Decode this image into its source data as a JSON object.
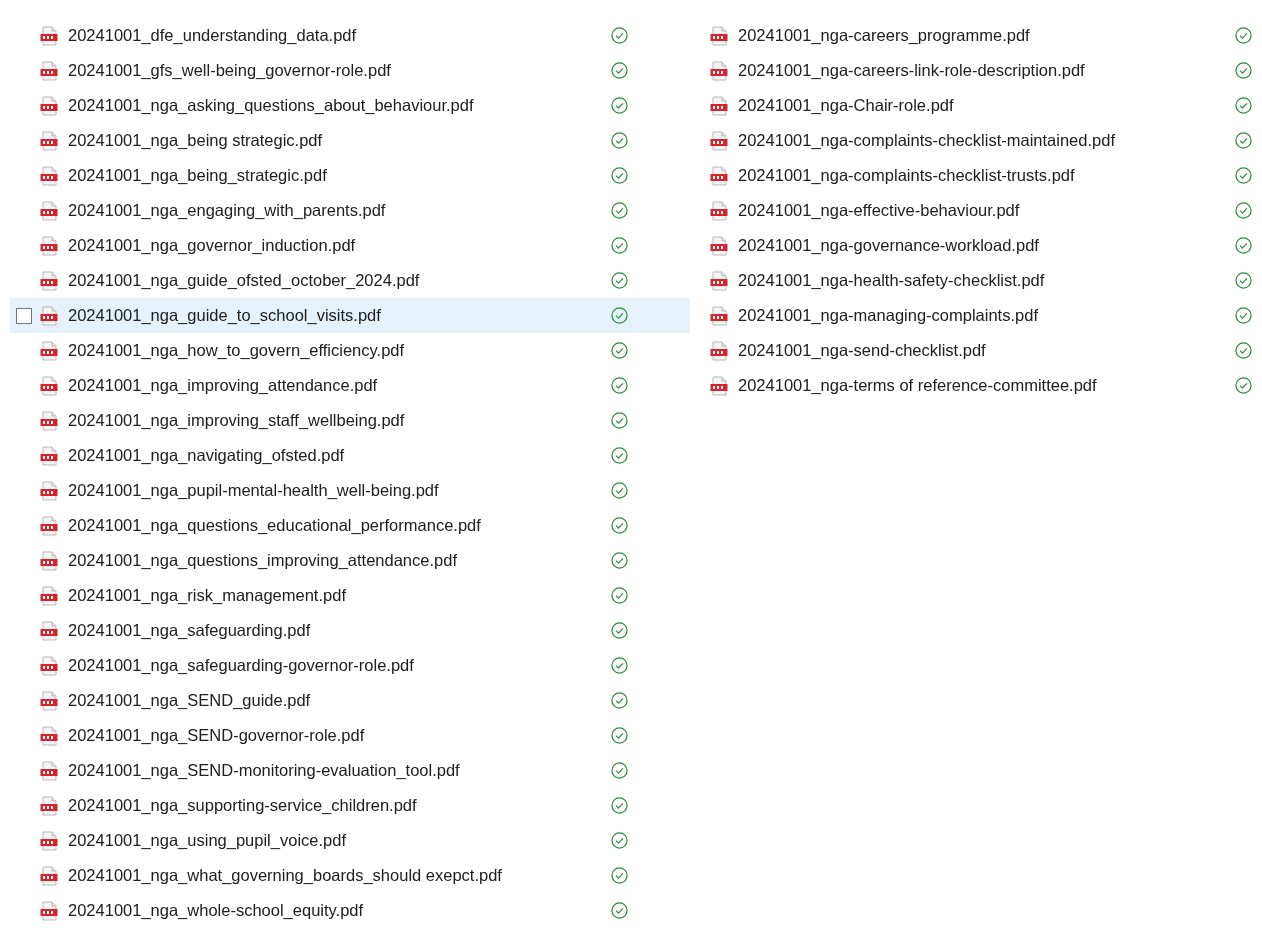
{
  "columns": [
    {
      "files": [
        {
          "name": "20241001_dfe_understanding_data.pdf",
          "hovered": false
        },
        {
          "name": "20241001_gfs_well-being_governor-role.pdf",
          "hovered": false
        },
        {
          "name": "20241001_nga_asking_questions_about_behaviour.pdf",
          "hovered": false
        },
        {
          "name": "20241001_nga_being strategic.pdf",
          "hovered": false
        },
        {
          "name": "20241001_nga_being_strategic.pdf",
          "hovered": false
        },
        {
          "name": "20241001_nga_engaging_with_parents.pdf",
          "hovered": false
        },
        {
          "name": "20241001_nga_governor_induction.pdf",
          "hovered": false
        },
        {
          "name": "20241001_nga_guide_ofsted_october_2024.pdf",
          "hovered": false
        },
        {
          "name": "20241001_nga_guide_to_school_visits.pdf",
          "hovered": true
        },
        {
          "name": "20241001_nga_how_to_govern_efficiency.pdf",
          "hovered": false
        },
        {
          "name": "20241001_nga_improving_attendance.pdf",
          "hovered": false
        },
        {
          "name": "20241001_nga_improving_staff_wellbeing.pdf",
          "hovered": false
        },
        {
          "name": "20241001_nga_navigating_ofsted.pdf",
          "hovered": false
        },
        {
          "name": "20241001_nga_pupil-mental-health_well-being.pdf",
          "hovered": false
        },
        {
          "name": "20241001_nga_questions_educational_performance.pdf",
          "hovered": false
        },
        {
          "name": "20241001_nga_questions_improving_attendance.pdf",
          "hovered": false
        },
        {
          "name": "20241001_nga_risk_management.pdf",
          "hovered": false
        },
        {
          "name": "20241001_nga_safeguarding.pdf",
          "hovered": false
        },
        {
          "name": "20241001_nga_safeguarding-governor-role.pdf",
          "hovered": false
        },
        {
          "name": "20241001_nga_SEND_guide.pdf",
          "hovered": false
        },
        {
          "name": "20241001_nga_SEND-governor-role.pdf",
          "hovered": false
        },
        {
          "name": "20241001_nga_SEND-monitoring-evaluation_tool.pdf",
          "hovered": false
        },
        {
          "name": "20241001_nga_supporting-service_children.pdf",
          "hovered": false
        },
        {
          "name": "20241001_nga_using_pupil_voice.pdf",
          "hovered": false
        },
        {
          "name": "20241001_nga_what_governing_boards_should exepct.pdf",
          "hovered": false
        },
        {
          "name": "20241001_nga_whole-school_equity.pdf",
          "hovered": false
        }
      ]
    },
    {
      "files": [
        {
          "name": "20241001_nga-careers_programme.pdf",
          "hovered": false
        },
        {
          "name": "20241001_nga-careers-link-role-description.pdf",
          "hovered": false
        },
        {
          "name": "20241001_nga-Chair-role.pdf",
          "hovered": false
        },
        {
          "name": "20241001_nga-complaints-checklist-maintained.pdf",
          "hovered": false
        },
        {
          "name": "20241001_nga-complaints-checklist-trusts.pdf",
          "hovered": false
        },
        {
          "name": "20241001_nga-effective-behaviour.pdf",
          "hovered": false
        },
        {
          "name": "20241001_nga-governance-workload.pdf",
          "hovered": false
        },
        {
          "name": "20241001_nga-health-safety-checklist.pdf",
          "hovered": false
        },
        {
          "name": "20241001_nga-managing-complaints.pdf",
          "hovered": false
        },
        {
          "name": "20241001_nga-send-checklist.pdf",
          "hovered": false
        },
        {
          "name": "20241001_nga-terms of reference-committee.pdf",
          "hovered": false
        }
      ]
    }
  ]
}
